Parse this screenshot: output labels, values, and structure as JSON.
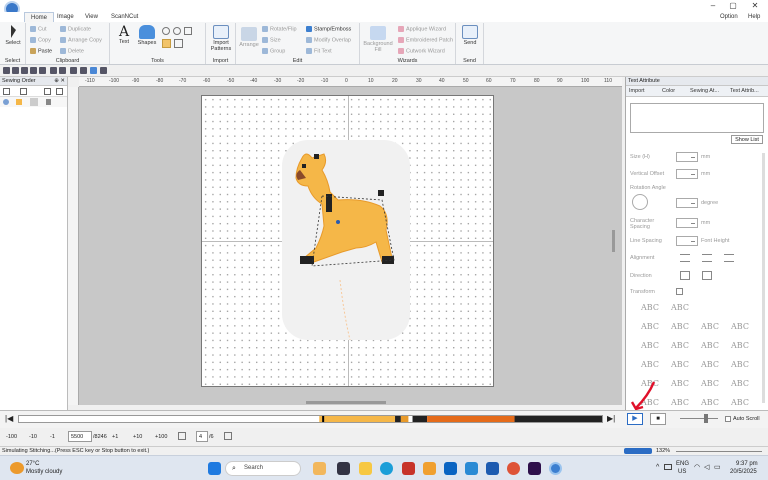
{
  "window": {
    "minimize_label": "–",
    "maximize_label": "▢",
    "close_label": "✕"
  },
  "tabs": [
    {
      "label": "Home",
      "active": true
    },
    {
      "label": "Image"
    },
    {
      "label": "View"
    },
    {
      "label": "ScanNCut"
    }
  ],
  "tab_right": {
    "option": "Option",
    "help": "Help"
  },
  "ribbon": {
    "select": {
      "button": "Select",
      "group": "Select"
    },
    "clipboard": {
      "cut": "Cut",
      "copy": "Copy",
      "paste": "Paste",
      "duplicate": "Duplicate",
      "arrange_copy": "Arrange Copy",
      "delete": "Delete",
      "group": "Clipboard"
    },
    "tools": {
      "text": "Text",
      "shapes": "Shapes",
      "group": "Tools"
    },
    "import": {
      "button": "Import Patterns",
      "group": "Import"
    },
    "edit": {
      "arrange": "Arrange",
      "rotate_flip": "Rotate/Flip",
      "size": "Size",
      "group_btn": "Group",
      "stamp_emboss": "Stamp/Emboss",
      "modify_overlap": "Modify Overlap",
      "fit_text": "Fit Text",
      "group": "Edit"
    },
    "wizards": {
      "background_fill": "Background Fill",
      "applique": "Applique Wizard",
      "embroidered_patch": "Embroidered Patch",
      "cutwork": "Cutwork Wizard",
      "group": "Wizards"
    },
    "send": {
      "button": "Send",
      "group": "Send"
    }
  },
  "sewing_order": {
    "title": "Sewing Order",
    "controls": "⊕ ✕"
  },
  "ruler_labels": [
    "-110",
    "-100",
    "-90",
    "-80",
    "-70",
    "-60",
    "-50",
    "-40",
    "-30",
    "-20",
    "-10",
    "0",
    "10",
    "20",
    "30",
    "40",
    "50",
    "60",
    "70",
    "80",
    "90",
    "100",
    "110"
  ],
  "text_attribute": {
    "title": "Text Attribute",
    "tabs": [
      "Import",
      "Color",
      "Sewing At...",
      "Text Attrib..."
    ],
    "show_list": "Show List",
    "fields": [
      {
        "label": "Size (H)",
        "unit": "mm"
      },
      {
        "label": "Vertical Offset",
        "unit": "mm"
      },
      {
        "label": "Rotation Angle",
        "unit": "degree"
      },
      {
        "label": "Character Spacing",
        "unit": "mm"
      },
      {
        "label": "Line Spacing",
        "unit": "Font Height"
      }
    ],
    "alignment_label": "Alignment",
    "direction_label": "Direction",
    "transform_label": "Transform",
    "transform_samples": [
      "ABC",
      "ABC"
    ],
    "abc_grid": [
      "ABC",
      "ABC",
      "ABC",
      "ABC",
      "ABC",
      "ABC",
      "ABC",
      "ABC",
      "ABC",
      "ABC",
      "ABC",
      "ABC",
      "ABC",
      "ABC",
      "ABC",
      "ABC",
      "ABC",
      "ABC",
      "ABC",
      "ABC"
    ]
  },
  "simulator": {
    "first_btn": "|◀",
    "last_btn": "▶|",
    "play_btn": "▶",
    "stop_btn": "■",
    "auto_scroll": "Auto Scroll",
    "progress_fraction": 0.52
  },
  "nav": {
    "back100": "-100",
    "back10": "-10",
    "back1": "-1",
    "stitch_current": "5500",
    "stitch_total": "/8246",
    "fwd1": "+1",
    "fwd10": "+10",
    "fwd100": "+100",
    "color_current": "4",
    "color_total": "/6"
  },
  "status": {
    "message": "Simulating Stitching...(Press ESC key or Stop button to exit.)",
    "zoom": "132%"
  },
  "taskbar": {
    "temp": "27°C",
    "weather": "Mostly cloudy",
    "search_placeholder": "Search",
    "lang": "ENG",
    "region": "US",
    "time": "9:37 pm",
    "date": "20/5/2025"
  },
  "colors": {
    "accent": "#2b6cc4",
    "giraffe": "#f5b748",
    "timeline_dark_orange": "#e56b1a"
  }
}
